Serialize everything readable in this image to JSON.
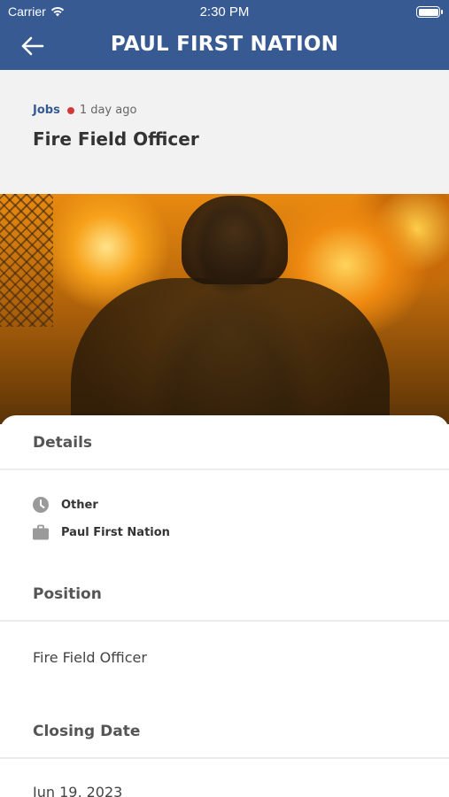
{
  "status_bar": {
    "carrier": "Carrier",
    "time": "2:30 PM"
  },
  "header": {
    "title": "PAUL FIRST NATION",
    "back_icon": "arrow-left-icon"
  },
  "post": {
    "category": "Jobs",
    "posted": "1 day ago",
    "title": "Fire Field Officer"
  },
  "hero_image": {
    "description_icon": "firefighter-photo"
  },
  "details": {
    "heading": "Details",
    "items": [
      {
        "icon": "clock-icon",
        "label": "Other"
      },
      {
        "icon": "briefcase-icon",
        "label": "Paul First Nation"
      }
    ]
  },
  "position": {
    "heading": "Position",
    "value": "Fire Field Officer"
  },
  "closing": {
    "heading": "Closing Date",
    "value": "Jun 19, 2023"
  },
  "colors": {
    "header_bg": "#375a93",
    "category": "#375a93",
    "dot": "#d23a3a"
  }
}
